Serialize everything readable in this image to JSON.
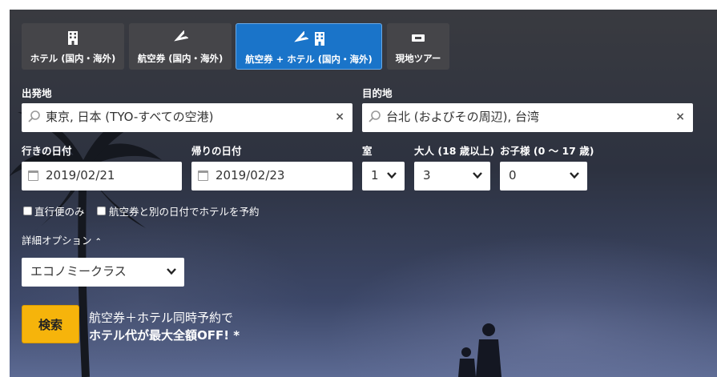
{
  "tabs": [
    {
      "label": "ホテル (国内・海外)",
      "icon": "building-icon"
    },
    {
      "label": "航空券 (国内・海外)",
      "icon": "plane-icon"
    },
    {
      "label": "航空券 + ホテル (国内・海外)",
      "icon": "plane-building-icon",
      "active": true
    },
    {
      "label": "現地ツアー",
      "icon": "ticket-icon"
    }
  ],
  "origin": {
    "label": "出発地",
    "value": "東京, 日本 (TYO-すべての空港)",
    "clear": "×"
  },
  "destination": {
    "label": "目的地",
    "value": "台北 (およびその周辺), 台湾",
    "clear": "×"
  },
  "depart": {
    "label": "行きの日付",
    "value": "2019/02/21"
  },
  "return": {
    "label": "帰りの日付",
    "value": "2019/02/23"
  },
  "rooms": {
    "label": "室",
    "value": "1"
  },
  "adults": {
    "label": "大人 (18 歳以上)",
    "value": "3"
  },
  "children": {
    "label": "お子様 (0 〜 17 歳)",
    "value": "0"
  },
  "options": {
    "direct_only": "直行便のみ",
    "separate_dates": "航空券と別の日付でホテルを予約"
  },
  "advanced": {
    "label": "詳細オプション",
    "toggle": "⌃"
  },
  "cabin": {
    "value": "エコノミークラス"
  },
  "search": {
    "label": "検索"
  },
  "promo": {
    "line1": "航空券＋ホテル同時予約で",
    "line2": "ホテル代が最大全額OFF! *"
  },
  "colors": {
    "accent": "#1a74c9",
    "search": "#f6b40b"
  }
}
